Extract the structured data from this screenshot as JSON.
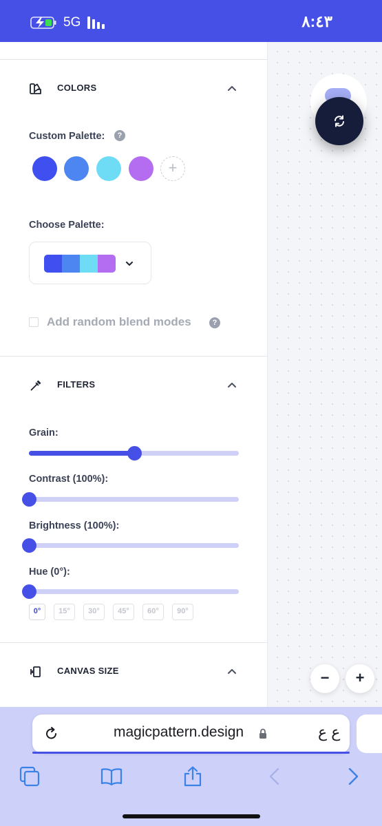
{
  "status_bar": {
    "network": "5G",
    "time": "٨:٤٣",
    "icons": [
      "battery-charging-icon",
      "signal-bars-icon"
    ]
  },
  "colors_section": {
    "title": "COLORS",
    "icon": "palette-icon",
    "custom_palette_label": "Custom Palette:",
    "custom_palette_swatches": [
      "#3f4ff0",
      "#4d86f0",
      "#6fdcf5",
      "#b46df0"
    ],
    "add_swatch_symbol": "+",
    "choose_palette_label": "Choose Palette:",
    "selected_palette": [
      "#3f4ff0",
      "#4d86f0",
      "#6fdcf5",
      "#b46df0"
    ],
    "blend_modes_label": "Add random blend modes",
    "blend_modes_checked": false,
    "help_symbol": "?"
  },
  "filters_section": {
    "title": "FILTERS",
    "icon": "eyedropper-icon",
    "sliders": [
      {
        "label": "Grain:",
        "value_fraction": 0.5
      },
      {
        "label": "Contrast (100%):",
        "value_fraction": 0.0
      },
      {
        "label": "Brightness (100%):",
        "value_fraction": 0.0
      },
      {
        "label": "Hue (0°):",
        "value_fraction": 0.0
      }
    ],
    "hue_presets": [
      "0°",
      "15°",
      "30°",
      "45°",
      "60°",
      "90°"
    ],
    "hue_selected": "0°"
  },
  "canvas_size_section": {
    "title": "CANVAS SIZE",
    "icon": "resize-icon"
  },
  "canvas": {
    "regenerate_icon": "refresh-icon",
    "zoom_out_label": "−",
    "zoom_in_label": "+"
  },
  "browser": {
    "url": "magicpattern.design",
    "reader_label": "ع ع",
    "toolbar_icons": [
      "tabs-icon",
      "bookmarks-icon",
      "share-icon",
      "back-icon",
      "forward-icon"
    ]
  },
  "accent_color": "#4650e6"
}
